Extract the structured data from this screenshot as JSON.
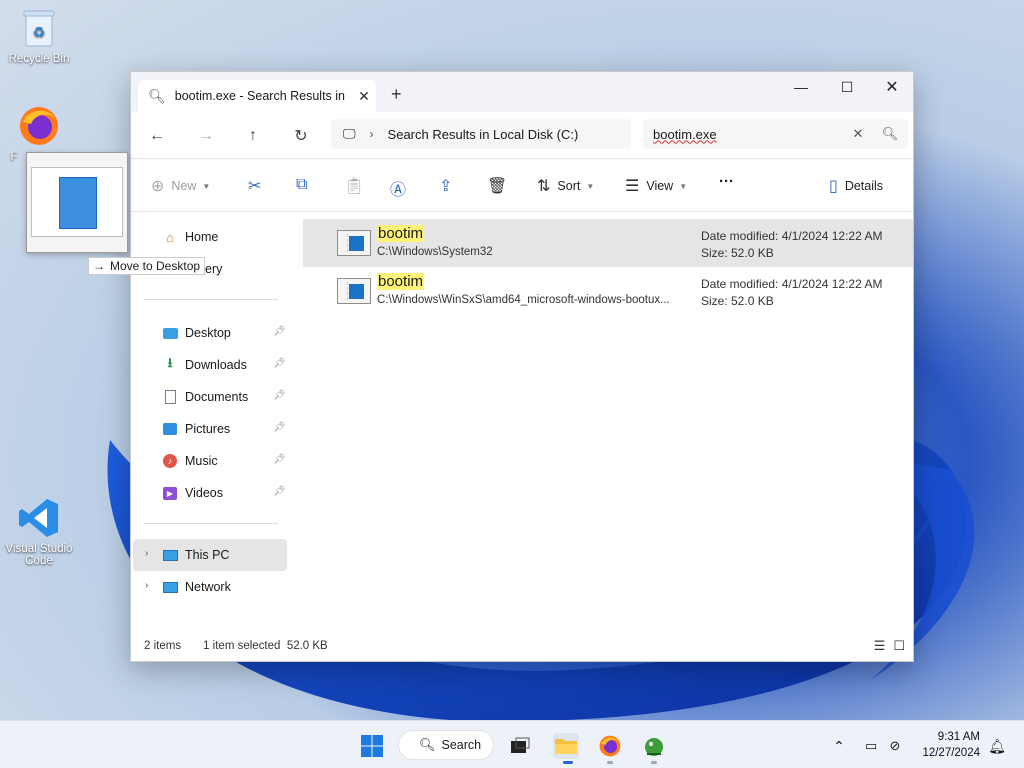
{
  "desktop": {
    "icons": [
      {
        "label": "Recycle Bin"
      },
      {
        "label": "F"
      },
      {
        "label": "Visual Studio Code"
      }
    ],
    "drag_tooltip": "Move to Desktop",
    "drag_arrow": "→"
  },
  "window": {
    "tab_title": "bootim.exe - Search Results in",
    "address": {
      "location": "Search Results in Local Disk (C:)"
    },
    "search": {
      "query": "bootim.exe"
    },
    "toolbar": {
      "new_label": "New",
      "sort_label": "Sort",
      "view_label": "View",
      "more_label": "···",
      "details_label": "Details"
    },
    "sidebar": {
      "home": "Home",
      "gallery_partial": "ery",
      "quick_access": [
        {
          "label": "Desktop"
        },
        {
          "label": "Downloads"
        },
        {
          "label": "Documents"
        },
        {
          "label": "Pictures"
        },
        {
          "label": "Music"
        },
        {
          "label": "Videos"
        }
      ],
      "this_pc": "This PC",
      "network": "Network"
    },
    "files": [
      {
        "name": "bootim",
        "path": "C:\\Windows\\System32",
        "date_modified": "Date modified: 4/1/2024 12:22 AM",
        "size": "Size: 52.0 KB",
        "selected": true
      },
      {
        "name": "bootim",
        "path": "C:\\Windows\\WinSxS\\amd64_microsoft-windows-bootux...",
        "date_modified": "Date modified: 4/1/2024 12:22 AM",
        "size": "Size: 52.0 KB",
        "selected": false
      }
    ],
    "status": {
      "count": "2 items",
      "selection": "1 item selected  52.0 KB"
    }
  },
  "taskbar": {
    "search_label": "Search",
    "time": "9:31 AM",
    "date": "12/27/2024"
  },
  "colors": {
    "accent": "#2a64c5",
    "highlight": "#fff37a",
    "selected_row": "#e5e5e5"
  }
}
